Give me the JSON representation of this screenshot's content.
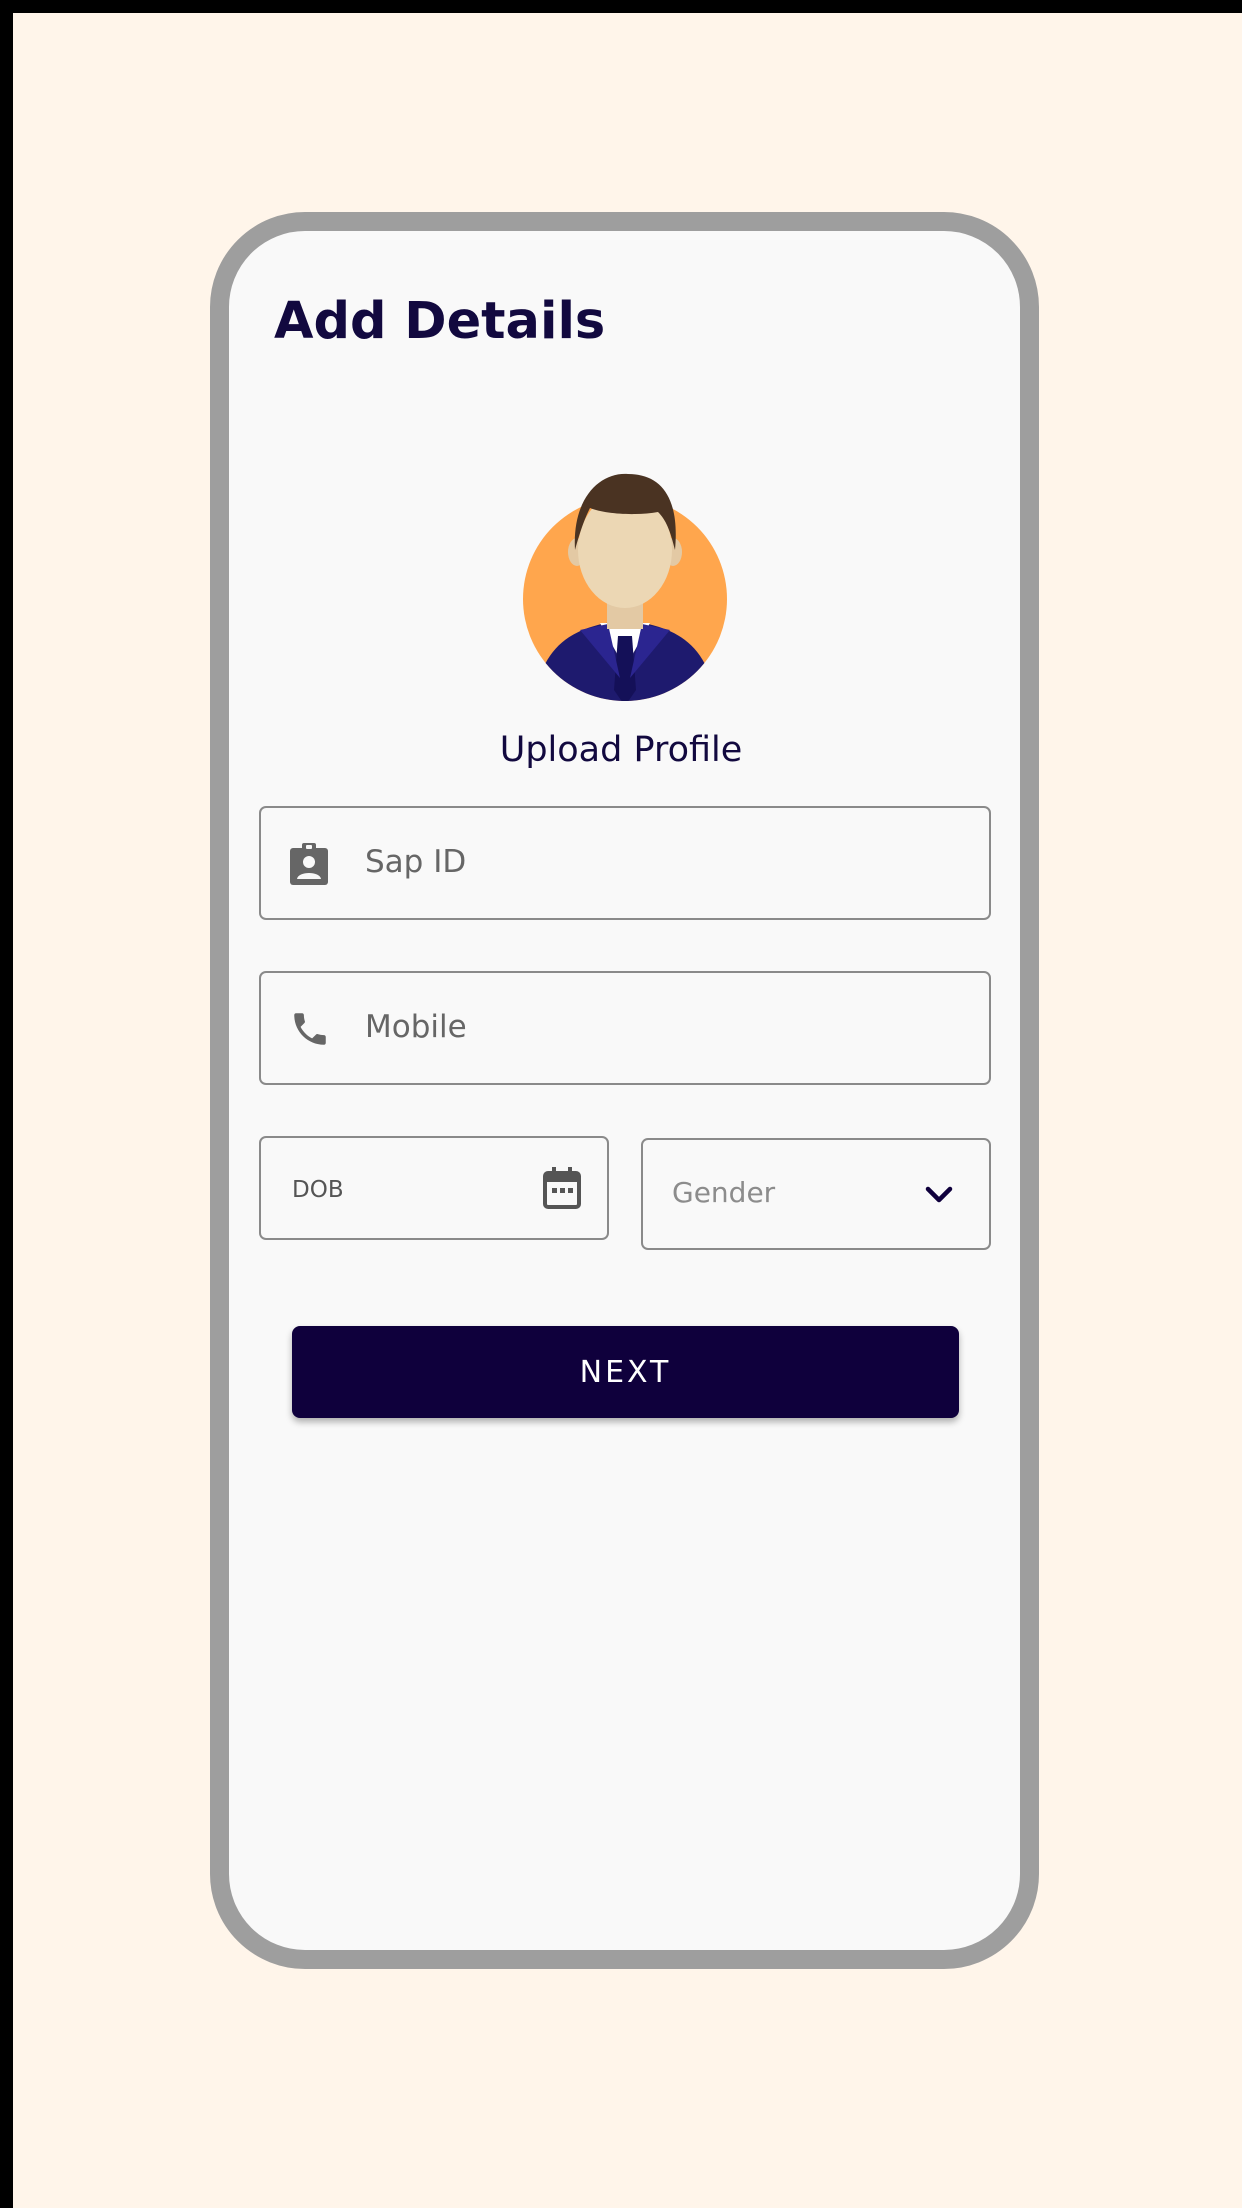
{
  "header": {
    "title": "Add Details"
  },
  "profile": {
    "upload_label": "Upload Profile",
    "avatar_icon": "person-avatar-icon"
  },
  "form": {
    "sap_id": {
      "placeholder": "Sap ID",
      "icon": "contact-badge-icon"
    },
    "mobile": {
      "placeholder": "Mobile",
      "icon": "phone-icon"
    },
    "dob": {
      "placeholder": "DOB",
      "icon": "calendar-icon"
    },
    "gender": {
      "placeholder": "Gender",
      "icon": "chevron-down-icon"
    }
  },
  "actions": {
    "next_label": "NEXT"
  },
  "colors": {
    "primary": "#0f003c",
    "title_text": "#12093f",
    "page_background": "#fff5ea",
    "phone_frame": "#9e9e9e",
    "screen_background": "#f9f9f9",
    "avatar_background": "#ffa64d"
  }
}
